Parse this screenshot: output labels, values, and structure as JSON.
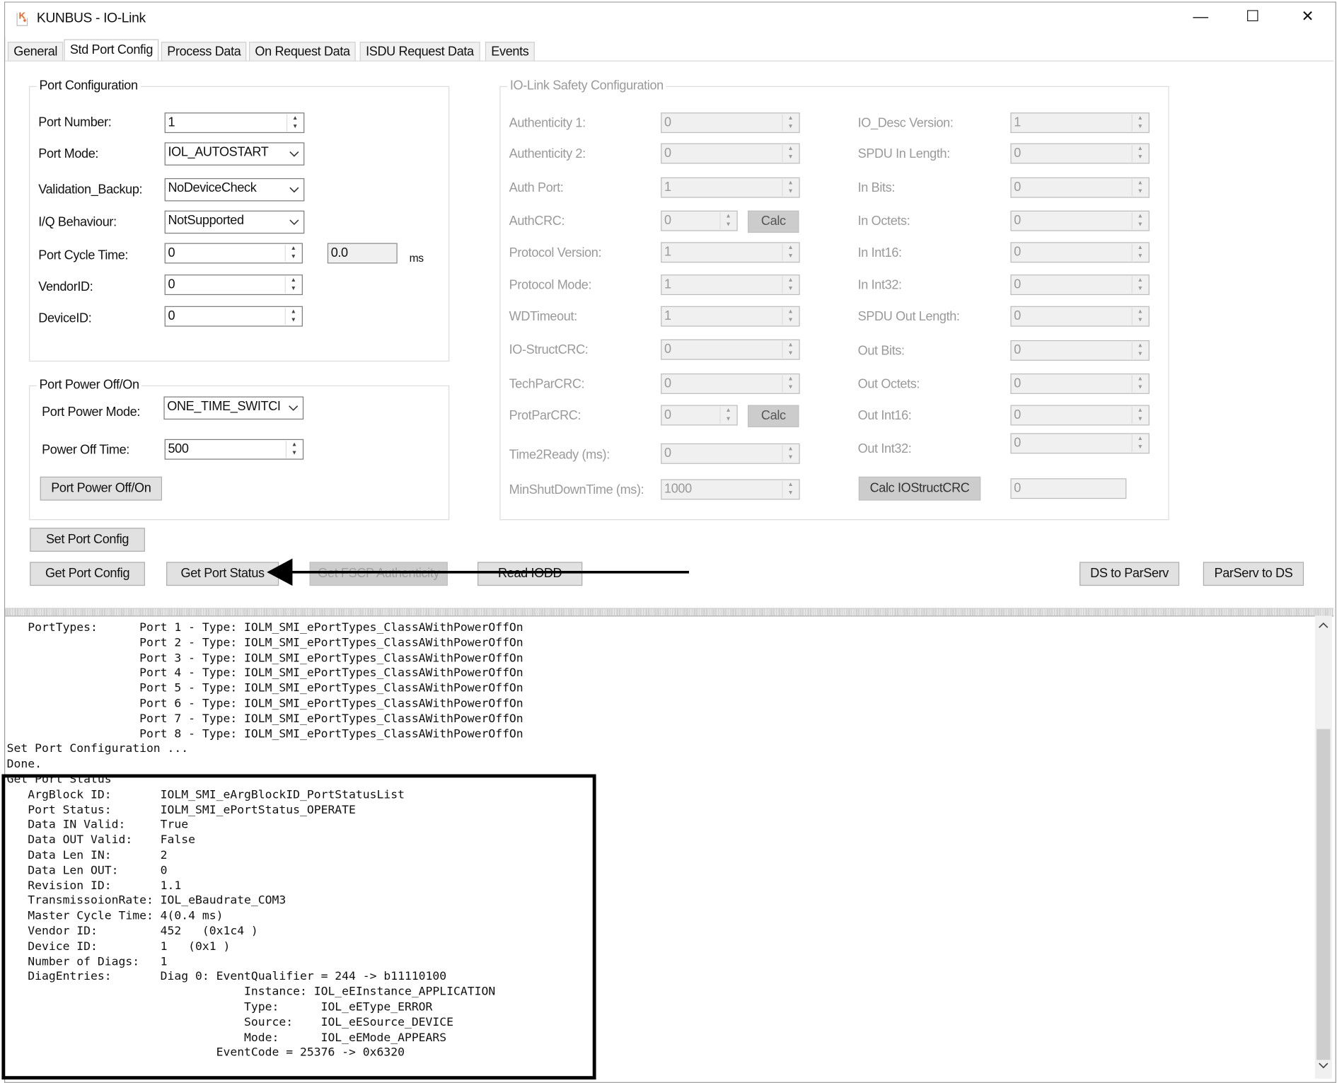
{
  "window": {
    "title": "KUNBUS - IO-Link",
    "minimize": "—",
    "maximize": "☐",
    "close": "✕"
  },
  "tabs": [
    {
      "label": "General"
    },
    {
      "label": "Std Port Config",
      "active": true
    },
    {
      "label": "Process Data"
    },
    {
      "label": "On Request Data"
    },
    {
      "label": "ISDU Request Data"
    },
    {
      "label": "Events"
    }
  ],
  "port_config": {
    "title": "Port Configuration",
    "port_number": {
      "label": "Port Number:",
      "value": "1"
    },
    "port_mode": {
      "label": "Port Mode:",
      "value": "IOL_AUTOSTART"
    },
    "validation_backup": {
      "label": "Validation_Backup:",
      "value": "NoDeviceCheck"
    },
    "iq_behaviour": {
      "label": "I/Q Behaviour:",
      "value": "NotSupported"
    },
    "port_cycle_time": {
      "label": "Port Cycle Time:",
      "value": "0",
      "ms_value": "0.0",
      "unit": "ms"
    },
    "vendor_id": {
      "label": "VendorID:",
      "value": "0"
    },
    "device_id": {
      "label": "DeviceID:",
      "value": "0"
    }
  },
  "port_power": {
    "title": "Port Power Off/On",
    "mode": {
      "label": "Port Power Mode:",
      "value": "ONE_TIME_SWITCI"
    },
    "off_time": {
      "label": "Power Off Time:",
      "value": "500"
    },
    "button": "Port Power Off/On"
  },
  "safety": {
    "title": "IO-Link Safety Configuration",
    "left": [
      {
        "label": "Authenticity 1:",
        "value": "0"
      },
      {
        "label": "Authenticity 2:",
        "value": "0"
      },
      {
        "label": "Auth Port:",
        "value": "1"
      },
      {
        "label": "AuthCRC:",
        "value": "0",
        "calc": "Calc"
      },
      {
        "label": "Protocol Version:",
        "value": "1"
      },
      {
        "label": "Protocol Mode:",
        "value": "1"
      },
      {
        "label": "WDTimeout:",
        "value": "1"
      },
      {
        "label": "IO-StructCRC:",
        "value": "0"
      },
      {
        "label": "TechParCRC:",
        "value": "0"
      },
      {
        "label": "ProtParCRC:",
        "value": "0",
        "calc": "Calc"
      },
      {
        "label": "Time2Ready (ms):",
        "value": "0"
      },
      {
        "label": "MinShutDownTime (ms):",
        "value": "1000"
      }
    ],
    "right": [
      {
        "label": "IO_Desc Version:",
        "value": "1"
      },
      {
        "label": "SPDU In Length:",
        "value": "0"
      },
      {
        "label": "In Bits:",
        "value": "0"
      },
      {
        "label": "In Octets:",
        "value": "0"
      },
      {
        "label": "In Int16:",
        "value": "0"
      },
      {
        "label": "In Int32:",
        "value": "0"
      },
      {
        "label": "SPDU Out Length:",
        "value": "0"
      },
      {
        "label": "Out Bits:",
        "value": "0"
      },
      {
        "label": "Out Octets:",
        "value": "0"
      },
      {
        "label": "Out Int16:",
        "value": "0"
      },
      {
        "label": "Out Int32:",
        "value": "0"
      }
    ],
    "calc_iostructcrc": "Calc IOStructCRC",
    "iostructcrc_value": "0"
  },
  "buttons": {
    "set_port_config": "Set Port Config",
    "get_port_config": "Get Port Config",
    "get_port_status": "Get Port Status",
    "get_fscp_authenticity": "Get FSCP Authenticity",
    "read_iodd": "Read IODD",
    "ds_to_parserv": "DS to ParServ",
    "parserv_to_ds": "ParServ to DS"
  },
  "log": {
    "lines": [
      "   PortTypes:      Port 1 - Type: IOLM_SMI_ePortTypes_ClassAWithPowerOffOn",
      "                   Port 2 - Type: IOLM_SMI_ePortTypes_ClassAWithPowerOffOn",
      "                   Port 3 - Type: IOLM_SMI_ePortTypes_ClassAWithPowerOffOn",
      "                   Port 4 - Type: IOLM_SMI_ePortTypes_ClassAWithPowerOffOn",
      "                   Port 5 - Type: IOLM_SMI_ePortTypes_ClassAWithPowerOffOn",
      "                   Port 6 - Type: IOLM_SMI_ePortTypes_ClassAWithPowerOffOn",
      "                   Port 7 - Type: IOLM_SMI_ePortTypes_ClassAWithPowerOffOn",
      "                   Port 8 - Type: IOLM_SMI_ePortTypes_ClassAWithPowerOffOn",
      "Set Port Configuration ...",
      "Done.",
      "Get Port Status",
      "   ArgBlock ID:       IOLM_SMI_eArgBlockID_PortStatusList",
      "   Port Status:       IOLM_SMI_ePortStatus_OPERATE",
      "   Data IN Valid:     True",
      "   Data OUT Valid:    False",
      "   Data Len IN:       2",
      "   Data Len OUT:      0",
      "   Revision ID:       1.1",
      "   TransmissoionRate: IOL_eBaudrate_COM3",
      "   Master Cycle Time: 4(0.4 ms)",
      "   Vendor ID:         452   (0x1c4 )",
      "   Device ID:         1   (0x1 )",
      "   Number of Diags:   1",
      "   DiagEntries:       Diag 0: EventQualifier = 244 -> b11110100",
      "                                  Instance: IOL_eEInstance_APPLICATION",
      "                                  Type:      IOL_eEType_ERROR",
      "                                  Source:    IOL_eESource_DEVICE",
      "                                  Mode:      IOL_eEMode_APPEARS",
      "                              EventCode = 25376 -> 0x6320"
    ]
  },
  "colors": {
    "logo": "#f26522",
    "disabled_text": "#9a9a9a",
    "highlight": "#000000"
  }
}
